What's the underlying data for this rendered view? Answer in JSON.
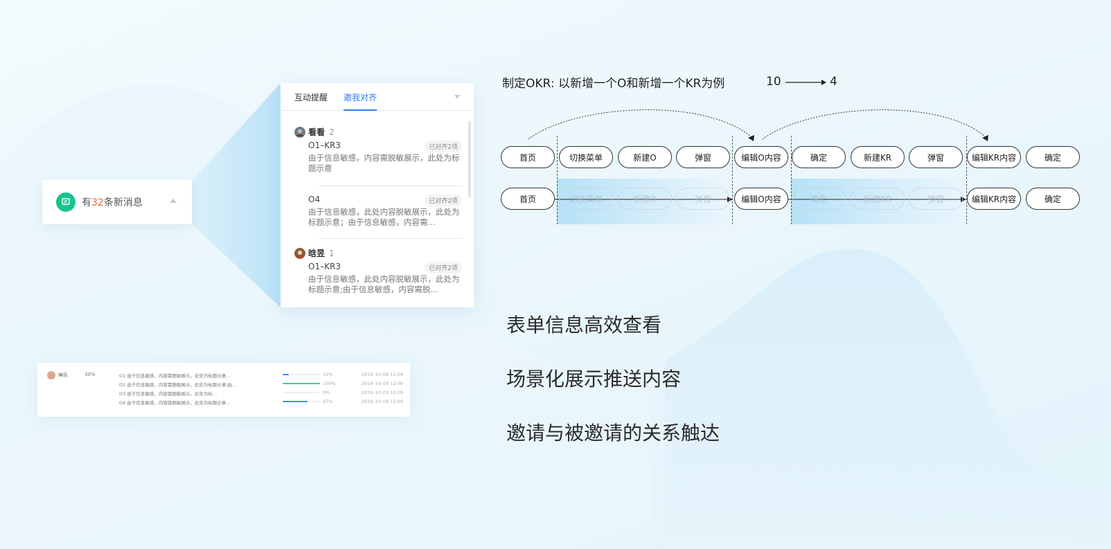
{
  "colors": {
    "accent": "#2e7cf6",
    "notify_icon": "#19c38f",
    "highlight_number": "#f0623a"
  },
  "notification": {
    "prefix": "有",
    "count": "32",
    "suffix": "条新消息",
    "icon": "chat-icon"
  },
  "panel": {
    "tabs": [
      "互动提醒",
      "邀我对齐"
    ],
    "active_tab": "邀我对齐",
    "groups": [
      {
        "name": "看看",
        "count": "2",
        "items": [
          {
            "code": "O1–KR3",
            "badge": "已对齐2项",
            "desc": "由于信息敏感，内容需脱敏展示，此处为标题示意"
          },
          {
            "code": "O4",
            "badge": "已对齐2项",
            "desc": "由于信息敏感，此处内容脱敏展示，此处为标题示意；由于信息敏感，内容需…"
          }
        ]
      },
      {
        "name": "晗昱",
        "count": "1",
        "items": [
          {
            "code": "O1–KR3",
            "badge": "已对齐2项",
            "desc": "由于信息敏感，此处内容脱敏展示，此处为标题示意;由于信息敏感，内容需脱…"
          }
        ]
      }
    ]
  },
  "table": {
    "name": "坤乐",
    "percent": "30%",
    "rows": [
      {
        "label": "O1  由于信息敏感，内容需脱敏展示，此处为标题示意…",
        "progress": 0.16,
        "pct": "16%",
        "color": "#3d8bf2",
        "date": "2019–10–09 12:09"
      },
      {
        "label": "O2  由于信息敏感，内容需脱敏展示，此处为标题示意;由…",
        "progress": 1.0,
        "pct": "100%",
        "color": "#2ed3a6",
        "date": "2019–10–09 12:09"
      },
      {
        "label": "O3  由于信息敏感，内容需脱敏展示，此处为标…",
        "progress": 0.0,
        "pct": "0%",
        "color": "#3d8bf2",
        "date": "2019–10–09 12:09"
      },
      {
        "label": "O4  由于信息敏感，内容需脱敏展示，此处为标题示意…",
        "progress": 0.67,
        "pct": "67%",
        "color": "#3d8bf2",
        "date": "2019–10–09 12:09"
      }
    ]
  },
  "flow": {
    "title": "制定OKR:  以新增一个O和新增一个KR为例",
    "steps_before": "10",
    "steps_after": "4",
    "row1": [
      "首页",
      "切换菜单",
      "新建O",
      "弹窗",
      "编辑O内容",
      "确定",
      "新建KR",
      "弹窗",
      "编辑KR内容",
      "确定"
    ],
    "row2": [
      "首页",
      "切换菜单",
      "新建O",
      "弹窗",
      "编辑O内容",
      "确定",
      "新建KR",
      "弹窗",
      "编辑KR内容",
      "确定"
    ],
    "row2_skipped": [
      false,
      true,
      true,
      true,
      false,
      true,
      true,
      true,
      false,
      false
    ]
  },
  "features": [
    "表单信息高效查看",
    "场景化展示推送内容",
    "邀请与被邀请的关系触达"
  ]
}
